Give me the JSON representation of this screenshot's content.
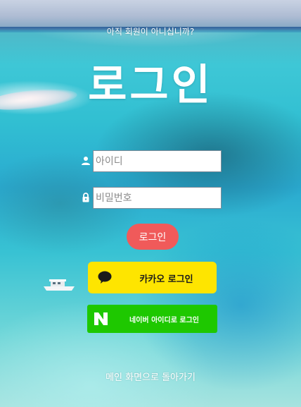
{
  "header": {
    "signup_prompt": "아직 회원이 아니십니까?",
    "title": "로그인"
  },
  "form": {
    "id_placeholder": "아이디",
    "password_placeholder": "비밀번호",
    "id_icon": "user-icon",
    "password_icon": "lock-icon",
    "login_label": "로그인"
  },
  "social": {
    "kakao_label": "카카오 로그인",
    "kakao_icon": "speech-bubble-icon",
    "naver_label": "네이버 아이디로 로그인",
    "naver_icon": "naver-n-icon"
  },
  "footer": {
    "back_label": "메인 화면으로 돌아가기"
  },
  "colors": {
    "login_button": "#f05a5a",
    "kakao": "#fee500",
    "naver": "#1ec800",
    "text": "#ffffff"
  }
}
